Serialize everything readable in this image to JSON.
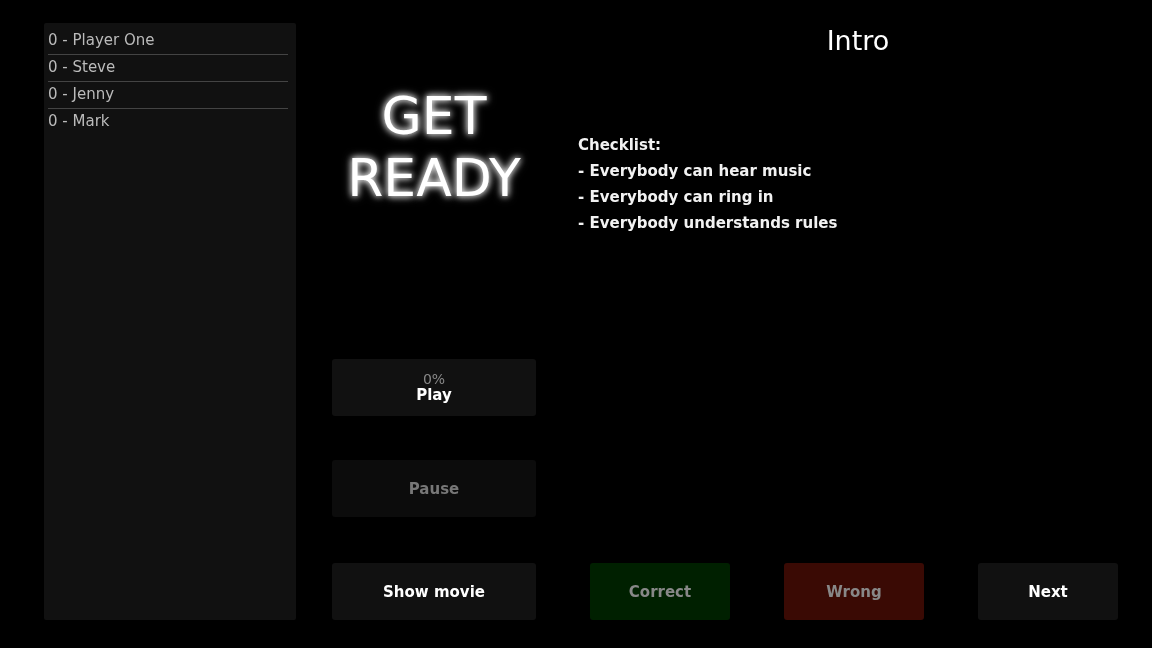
{
  "players": [
    {
      "name": "0 - Player One"
    },
    {
      "name": "0 - Steve"
    },
    {
      "name": "0 - Jenny"
    },
    {
      "name": "0 - Mark"
    }
  ],
  "status": "GET READY",
  "round_title": "Intro",
  "notes": [
    "Checklist:",
    "- Everybody can hear music",
    "- Everybody can ring in",
    "- Everybody understands rules"
  ],
  "play_button": {
    "progress": "0%",
    "label": "Play",
    "disabled": false
  },
  "pause_button": {
    "label": "Pause",
    "disabled": true
  },
  "bottom_buttons": [
    {
      "label": "Show movie",
      "kind": "neutral",
      "disabled": false
    },
    {
      "label": "Correct",
      "kind": "correct",
      "disabled": true
    },
    {
      "label": "Wrong",
      "kind": "wrong",
      "disabled": true
    },
    {
      "label": "Next",
      "kind": "neutral",
      "disabled": false
    }
  ]
}
